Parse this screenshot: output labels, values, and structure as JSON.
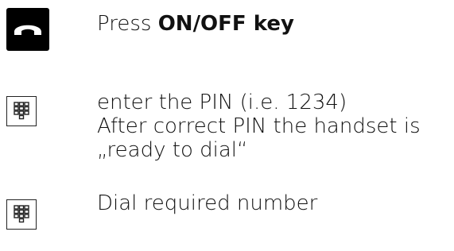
{
  "steps": [
    {
      "icon": "onoff-key-icon",
      "prefix": "Press ",
      "emphasis": "ON/OFF key"
    },
    {
      "icon": "keypad-icon",
      "line1": "enter the PIN  (i.e. 1234)",
      "line2": "After correct PIN the handset is",
      "line3": "„ready to dial“"
    },
    {
      "icon": "keypad-icon",
      "line1": "Dial required number"
    }
  ]
}
